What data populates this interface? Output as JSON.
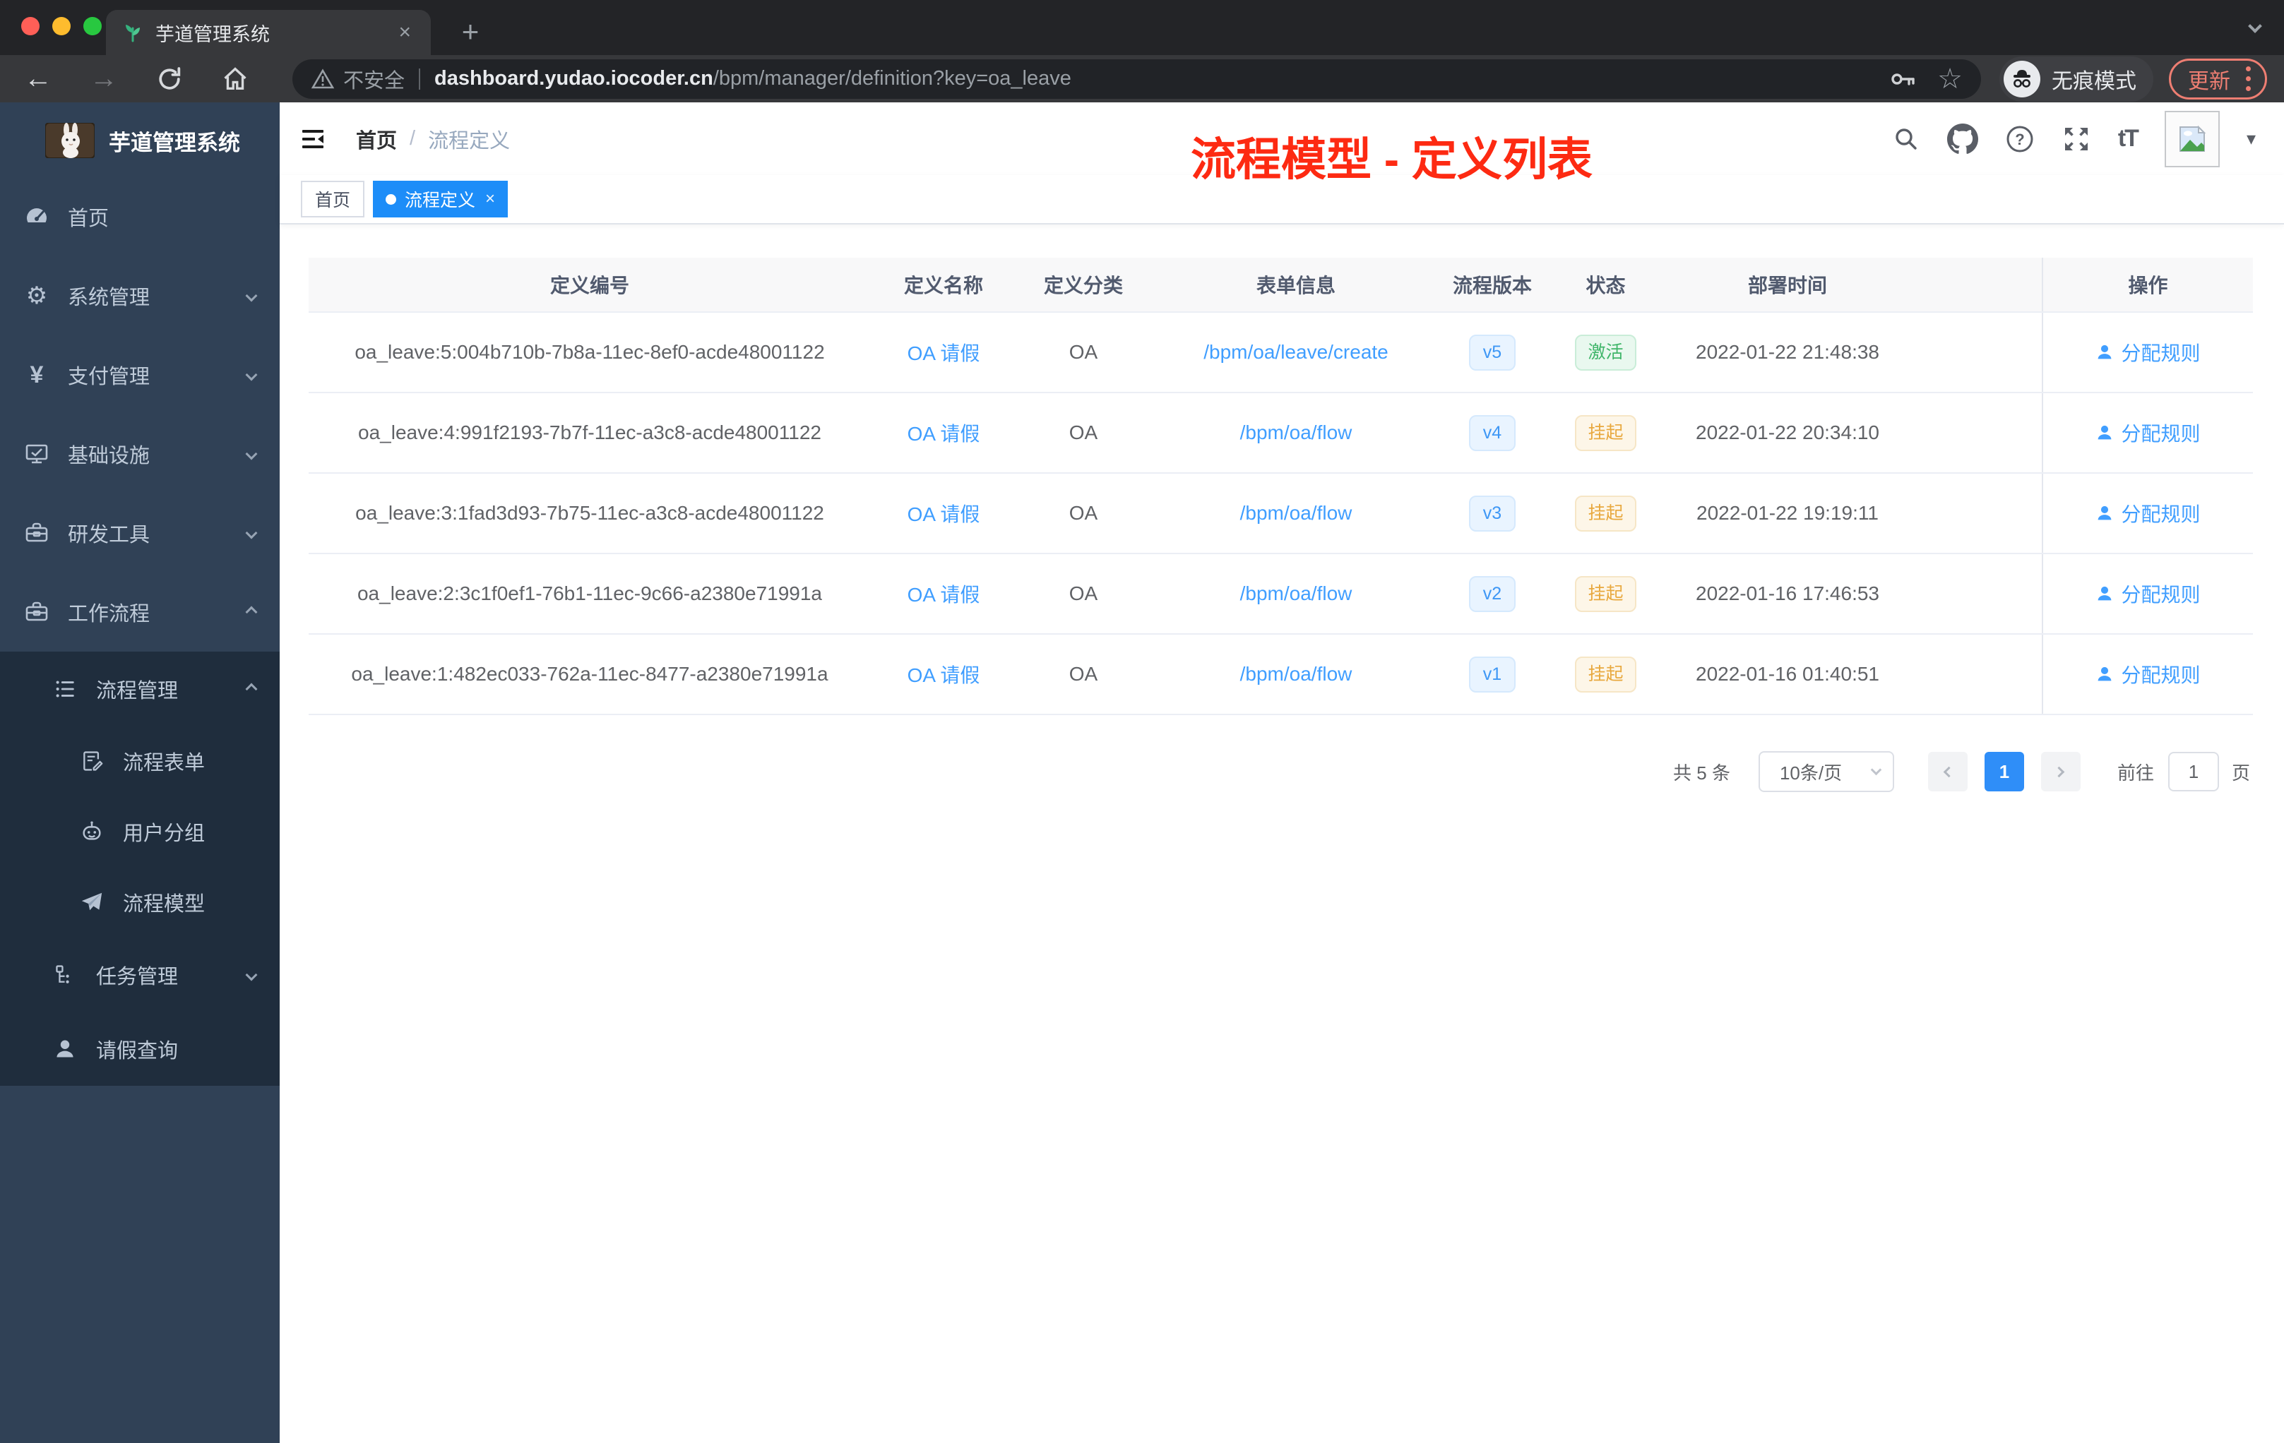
{
  "colors": {
    "accent_blue": "#409eff",
    "tag_active_blue": "#1d8df8",
    "sidebar_bg": "#304156",
    "sidebar_submenu_bg": "#1f2d3d",
    "annotation_red": "#fd2a12",
    "status_active_green": "#3fb569",
    "status_suspend_orange": "#e8a83e",
    "update_button_red": "#ee7e72"
  },
  "browser": {
    "tab_title": "芋道管理系统",
    "security_label": "不安全",
    "url_host": "dashboard.yudao.iocoder.cn",
    "url_path": "/bpm/manager/definition?key=oa_leave",
    "incognito_label": "无痕模式",
    "update_label": "更新"
  },
  "glyphs": {
    "close": "×",
    "plus": "+",
    "back": "←",
    "forward": "→",
    "question": "?",
    "font_size": "tT",
    "star": "☆",
    "yen": "¥",
    "gear": "⚙",
    "caret_down": "▾"
  },
  "sidebar": {
    "logo_title": "芋道管理系统",
    "menu": [
      {
        "label": "首页"
      },
      {
        "label": "系统管理"
      },
      {
        "label": "支付管理"
      },
      {
        "label": "基础设施"
      },
      {
        "label": "研发工具"
      },
      {
        "label": "工作流程"
      },
      {
        "label": "流程管理"
      },
      {
        "label": "流程表单"
      },
      {
        "label": "用户分组"
      },
      {
        "label": "流程模型"
      },
      {
        "label": "任务管理"
      },
      {
        "label": "请假查询"
      }
    ]
  },
  "navbar": {
    "breadcrumb_home": "首页",
    "breadcrumb_sep": "/",
    "breadcrumb_current": "流程定义"
  },
  "annotation": "流程模型 - 定义列表",
  "tags": {
    "home": "首页",
    "current": "流程定义",
    "close": "×"
  },
  "table": {
    "columns": [
      "定义编号",
      "定义名称",
      "定义分类",
      "表单信息",
      "流程版本",
      "状态",
      "部署时间",
      "操作"
    ],
    "rows": [
      {
        "id": "oa_leave:5:004b710b-7b8a-11ec-8ef0-acde48001122",
        "name": "OA 请假",
        "category": "OA",
        "form": "/bpm/oa/leave/create",
        "version": "v5",
        "status": "激活",
        "time": "2022-01-22 21:48:38",
        "action": "分配规则"
      },
      {
        "id": "oa_leave:4:991f2193-7b7f-11ec-a3c8-acde48001122",
        "name": "OA 请假",
        "category": "OA",
        "form": "/bpm/oa/flow",
        "version": "v4",
        "status": "挂起",
        "time": "2022-01-22 20:34:10",
        "action": "分配规则"
      },
      {
        "id": "oa_leave:3:1fad3d93-7b75-11ec-a3c8-acde48001122",
        "name": "OA 请假",
        "category": "OA",
        "form": "/bpm/oa/flow",
        "version": "v3",
        "status": "挂起",
        "time": "2022-01-22 19:19:11",
        "action": "分配规则"
      },
      {
        "id": "oa_leave:2:3c1f0ef1-76b1-11ec-9c66-a2380e71991a",
        "name": "OA 请假",
        "category": "OA",
        "form": "/bpm/oa/flow",
        "version": "v2",
        "status": "挂起",
        "time": "2022-01-16 17:46:53",
        "action": "分配规则"
      },
      {
        "id": "oa_leave:1:482ec033-762a-11ec-8477-a2380e71991a",
        "name": "OA 请假",
        "category": "OA",
        "form": "/bpm/oa/flow",
        "version": "v1",
        "status": "挂起",
        "time": "2022-01-16 01:40:51",
        "action": "分配规则"
      }
    ]
  },
  "pagination": {
    "total": "共 5 条",
    "page_size": "10条/页",
    "current": "1",
    "goto_label": "前往",
    "goto_value": "1",
    "unit": "页"
  }
}
